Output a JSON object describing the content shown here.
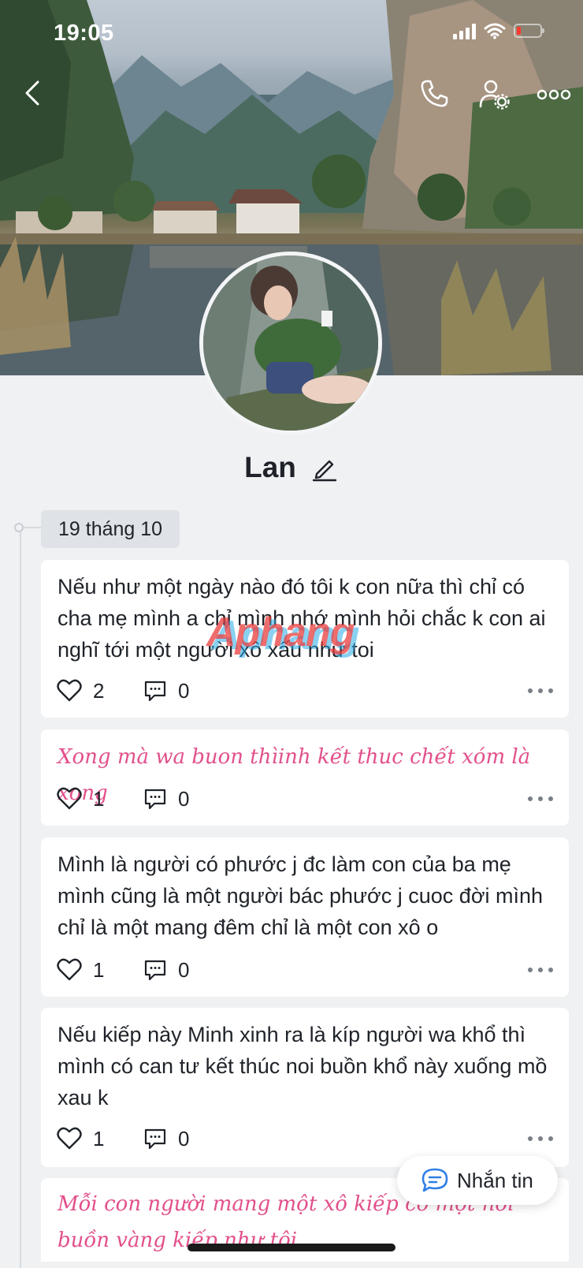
{
  "status": {
    "time": "19:05"
  },
  "profile": {
    "name": "Lan"
  },
  "timeline": {
    "date": "19 tháng 10"
  },
  "posts": [
    {
      "text": "Nếu như một ngày nào đó tôi k con nữa thì chỉ có cha mẹ mình a chỉ mình nhớ mình hỏi chắc k con ai nghĩ tới một người xô xấu như toi",
      "likes": "2",
      "comments": "0"
    },
    {
      "text": "Xong mà wa buon thìinh kết thuc chết xóm là xong",
      "likes": "1",
      "comments": "0"
    },
    {
      "text": "Mình là người có phước j đc làm con của ba mẹ mình cũng là một người bác phước j cuoc đời mình chỉ là một mang đêm chỉ là một con xô o",
      "likes": "1",
      "comments": "0"
    },
    {
      "text": "Nếu kiếp này Minh xinh ra là kíp người wa khổ thì mình có can tư kết thúc noi buồn khổ này xuống mồ xau k",
      "likes": "1",
      "comments": "0"
    },
    {
      "text": "Mỗi con người mang một xô kiếp có một nỗi buồn vàng kiếp như tôi"
    }
  ],
  "watermark": "Aphang",
  "fab": {
    "label": "Nhắn tin"
  },
  "colors": {
    "accent": "#2f7ee6",
    "script_text": "#e2508b",
    "background": "#eff1f3"
  },
  "icons": [
    "back-icon",
    "phone-icon",
    "user-settings-icon",
    "more-icon",
    "edit-icon",
    "heart-icon",
    "comment-icon",
    "chat-icon"
  ]
}
